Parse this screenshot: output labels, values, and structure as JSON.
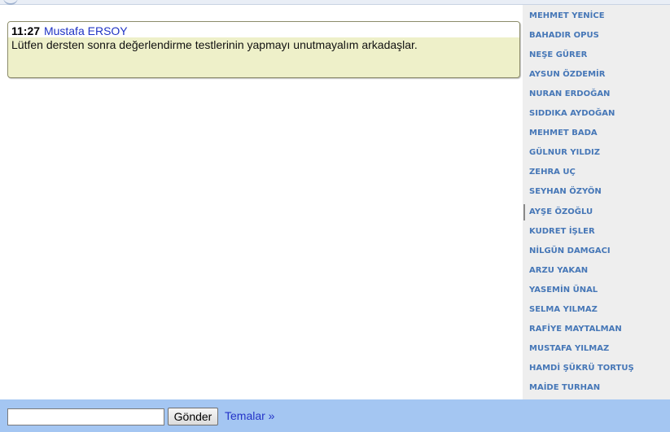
{
  "message": {
    "time": "11:27",
    "author": "Mustafa ERSOY",
    "text": "Lütfen dersten sonra değerlendirme testlerinin yapmayı unutmayalım arkadaşlar."
  },
  "users": [
    "MEHMET YENİCE",
    "BAHADIR OPUS",
    "NEŞE GÜRER",
    "AYSUN ÖZDEMİR",
    "NURAN ERDOĞAN",
    "SIDDIKA AYDOĞAN",
    "MEHMET BADA",
    "GÜLNUR YILDIZ",
    "ZEHRA UÇ",
    "SEYHAN ÖZYÖN",
    "AYŞE ÖZOĞLU",
    "KUDRET İŞLER",
    "NİLGÜN DAMGACI",
    "ARZU YAKAN",
    "YASEMİN ÜNAL",
    "SELMA YILMAZ",
    "RAFİYE MAYTALMAN",
    "MUSTAFA YILMAZ",
    "HAMDİ ŞÜKRÜ TORTUŞ",
    "MAİDE TURHAN"
  ],
  "input": {
    "value": "",
    "placeholder": ""
  },
  "send_label": "Gönder",
  "themes_label": "Temalar »",
  "colors": {
    "user_name": "#4677b7",
    "author": "#1f33c4",
    "message_bg": "#eef0c9",
    "bottom_bar": "#a4c6f2",
    "sidebar_bg": "#eeeeee"
  }
}
